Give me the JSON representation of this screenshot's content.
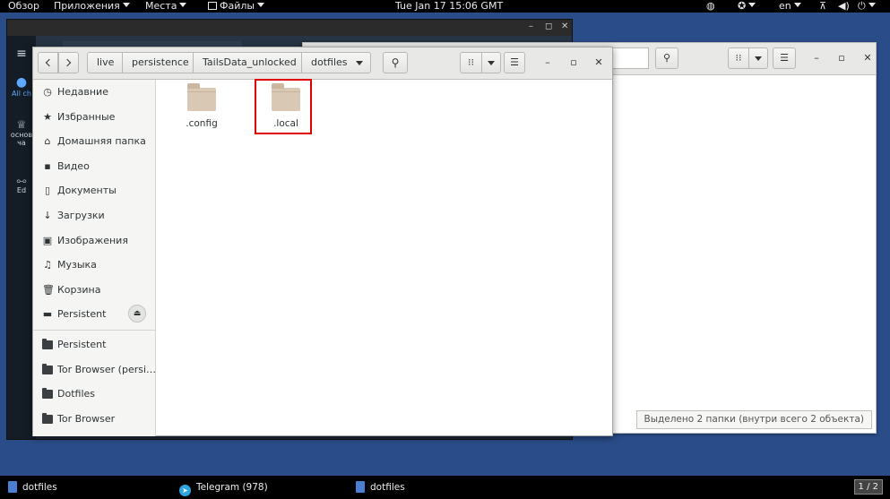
{
  "topbar": {
    "activities": "Обзор",
    "apps": "Приложения",
    "places": "Места",
    "files": "Файлы",
    "clock": "Tue Jan 17 15:06 GMT",
    "lang": "en"
  },
  "bg_window": {
    "sidebar_items": [
      "All ch",
      "основ ча",
      "Ed"
    ]
  },
  "right_window": {
    "status": "Выделено 2 папки (внутри всего 2 объекта)"
  },
  "main_window": {
    "breadcrumbs": [
      "live",
      "persistence",
      "TailsData_unlocked",
      "dotfiles"
    ],
    "sidebar": {
      "places": [
        {
          "label": "Недавние",
          "icon": "clock-icon"
        },
        {
          "label": "Избранные",
          "icon": "star-icon"
        },
        {
          "label": "Домашняя папка",
          "icon": "home-icon"
        },
        {
          "label": "Видео",
          "icon": "video-icon"
        },
        {
          "label": "Документы",
          "icon": "document-icon"
        },
        {
          "label": "Загрузки",
          "icon": "download-icon"
        },
        {
          "label": "Изображения",
          "icon": "image-icon"
        },
        {
          "label": "Музыка",
          "icon": "music-icon"
        },
        {
          "label": "Корзина",
          "icon": "trash-icon"
        },
        {
          "label": "Persistent",
          "icon": "drive-icon"
        }
      ],
      "bookmarks": [
        "Persistent",
        "Tor Browser (persi…",
        "Dotfiles",
        "Tor Browser"
      ]
    },
    "files": [
      ".config",
      ".local"
    ]
  },
  "taskbar": {
    "tasks": [
      "dotfiles",
      "Telegram (978)",
      "dotfiles"
    ],
    "workspace": "1 / 2"
  },
  "colors": {
    "desktop": "#2a4d8a",
    "highlight": "#e00000",
    "folder": "#d9c8b4"
  }
}
